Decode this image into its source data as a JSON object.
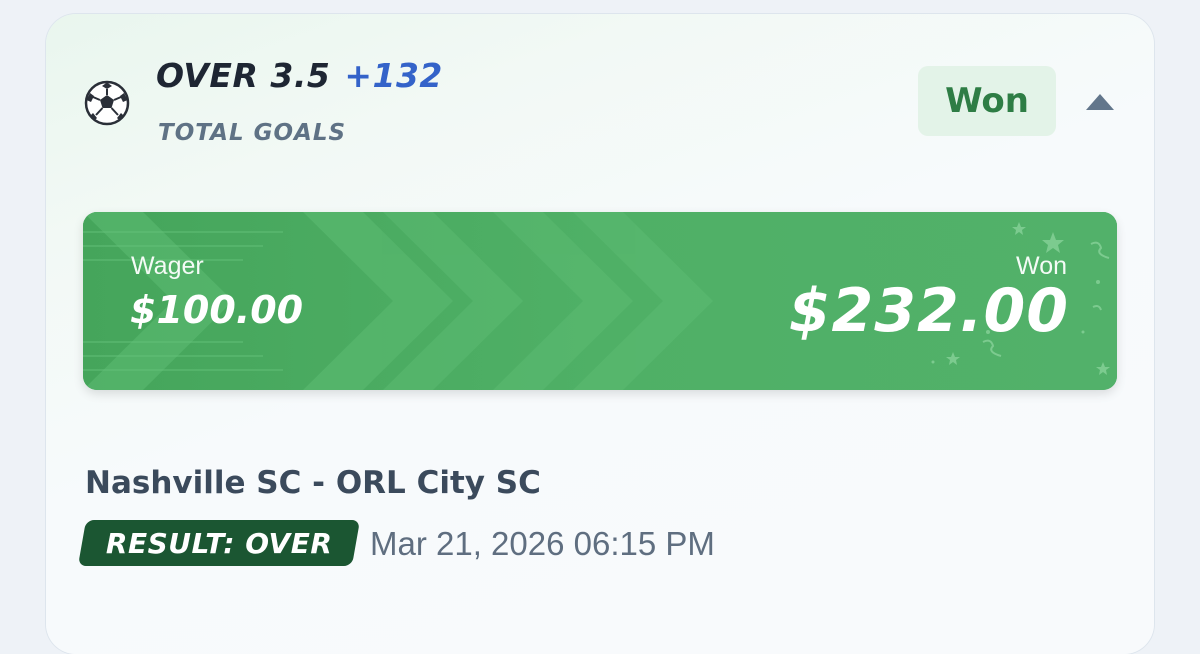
{
  "bet": {
    "selection": "OVER 3.5",
    "odds": "+132",
    "market": "TOTAL GOALS",
    "status": "Won",
    "sport_icon": "soccer-ball-icon",
    "collapse_icon": "chevron-up-icon"
  },
  "payout": {
    "wager_label": "Wager",
    "wager_value": "$100.00",
    "won_label": "Won",
    "won_value": "$232.00"
  },
  "event": {
    "matchup": "Nashville SC - ORL City SC",
    "result": "RESULT: OVER",
    "datetime": "Mar 21, 2026 06:15 PM"
  },
  "colors": {
    "banner_green": "#4fad63",
    "badge_bg": "#e3f3e8",
    "badge_text": "#2e7d45",
    "odds_blue": "#3463c9",
    "result_dark_green": "#1b5632"
  }
}
